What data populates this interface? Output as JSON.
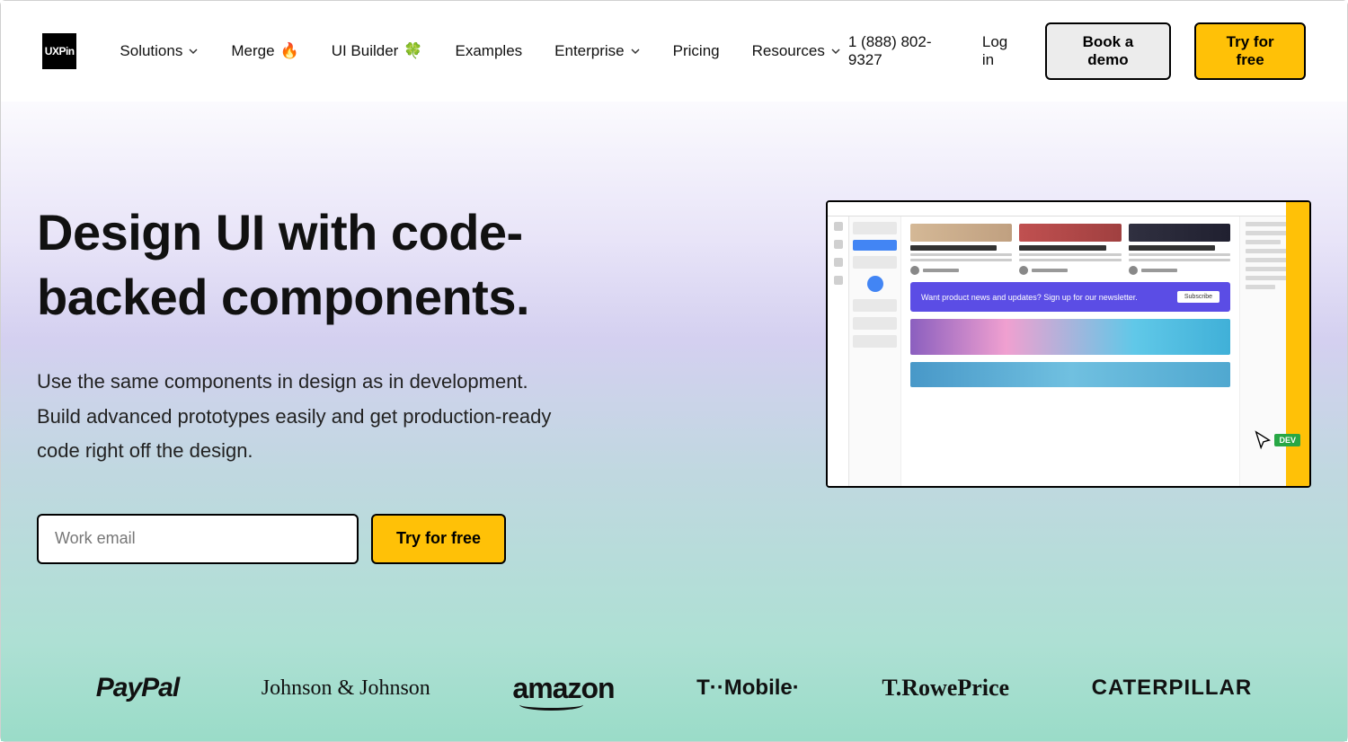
{
  "brand": "UXPin",
  "nav": {
    "items": [
      {
        "label": "Solutions",
        "dropdown": true,
        "emoji": ""
      },
      {
        "label": "Merge",
        "dropdown": false,
        "emoji": "🔥"
      },
      {
        "label": "UI Builder",
        "dropdown": false,
        "emoji": "🍀"
      },
      {
        "label": "Examples",
        "dropdown": false,
        "emoji": ""
      },
      {
        "label": "Enterprise",
        "dropdown": true,
        "emoji": ""
      },
      {
        "label": "Pricing",
        "dropdown": false,
        "emoji": ""
      },
      {
        "label": "Resources",
        "dropdown": true,
        "emoji": ""
      }
    ],
    "phone": "1 (888) 802-9327",
    "login_label": "Log in",
    "demo_label": "Book a demo",
    "try_label": "Try for free"
  },
  "hero": {
    "title": "Design UI with code-backed components.",
    "subtitle": "Use the same components in design as in development. Build advanced prototypes easily and get production-ready code right off the design.",
    "email_placeholder": "Work email",
    "cta_label": "Try for free"
  },
  "screenshot": {
    "banner_text": "Want product news and updates? Sign up for our newsletter.",
    "banner_button": "Subscribe",
    "cursor_tag": "DEV"
  },
  "logos": {
    "paypal": "PayPal",
    "jnj": "Johnson & Johnson",
    "amazon": "amazon",
    "tmobile": "T··Mobile·",
    "trowe": "T.RowePrice",
    "cat": "CATERPILLAR"
  }
}
